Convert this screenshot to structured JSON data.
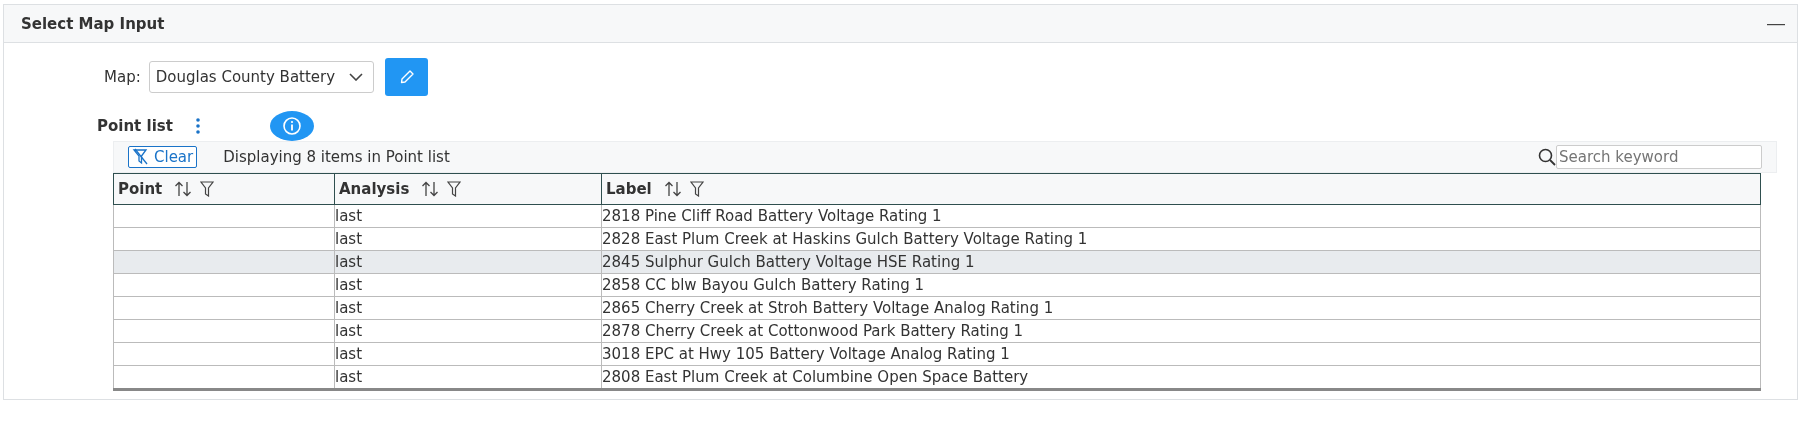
{
  "panel": {
    "title": "Select Map Input",
    "collapse_symbol": "—"
  },
  "map": {
    "label": "Map:",
    "value": "Douglas County Battery"
  },
  "point_list": {
    "title": "Point list",
    "clear_label": "Clear",
    "summary": "Displaying 8 items in Point list",
    "search": {
      "placeholder": "Search keyword"
    }
  },
  "table": {
    "columns": [
      "Point",
      "Analysis",
      "Label"
    ],
    "rows": [
      {
        "point": "",
        "analysis": "last",
        "label": "2818 Pine Cliff Road Battery Voltage Rating 1",
        "selected": false
      },
      {
        "point": "",
        "analysis": "last",
        "label": "2828 East Plum Creek at Haskins Gulch Battery Voltage Rating 1",
        "selected": false
      },
      {
        "point": "",
        "analysis": "last",
        "label": "2845 Sulphur Gulch Battery Voltage HSE Rating 1",
        "selected": true
      },
      {
        "point": "",
        "analysis": "last",
        "label": "2858 CC blw Bayou Gulch Battery Rating 1",
        "selected": false
      },
      {
        "point": "",
        "analysis": "last",
        "label": "2865 Cherry Creek at Stroh Battery Voltage Analog Rating 1",
        "selected": false
      },
      {
        "point": "",
        "analysis": "last",
        "label": "2878 Cherry Creek at Cottonwood Park Battery Rating 1",
        "selected": false
      },
      {
        "point": "",
        "analysis": "last",
        "label": "3018 EPC at Hwy 105 Battery Voltage Analog Rating 1",
        "selected": false
      },
      {
        "point": "",
        "analysis": "last",
        "label": "2808 East Plum Creek at Columbine Open Space Battery",
        "selected": false
      }
    ]
  }
}
